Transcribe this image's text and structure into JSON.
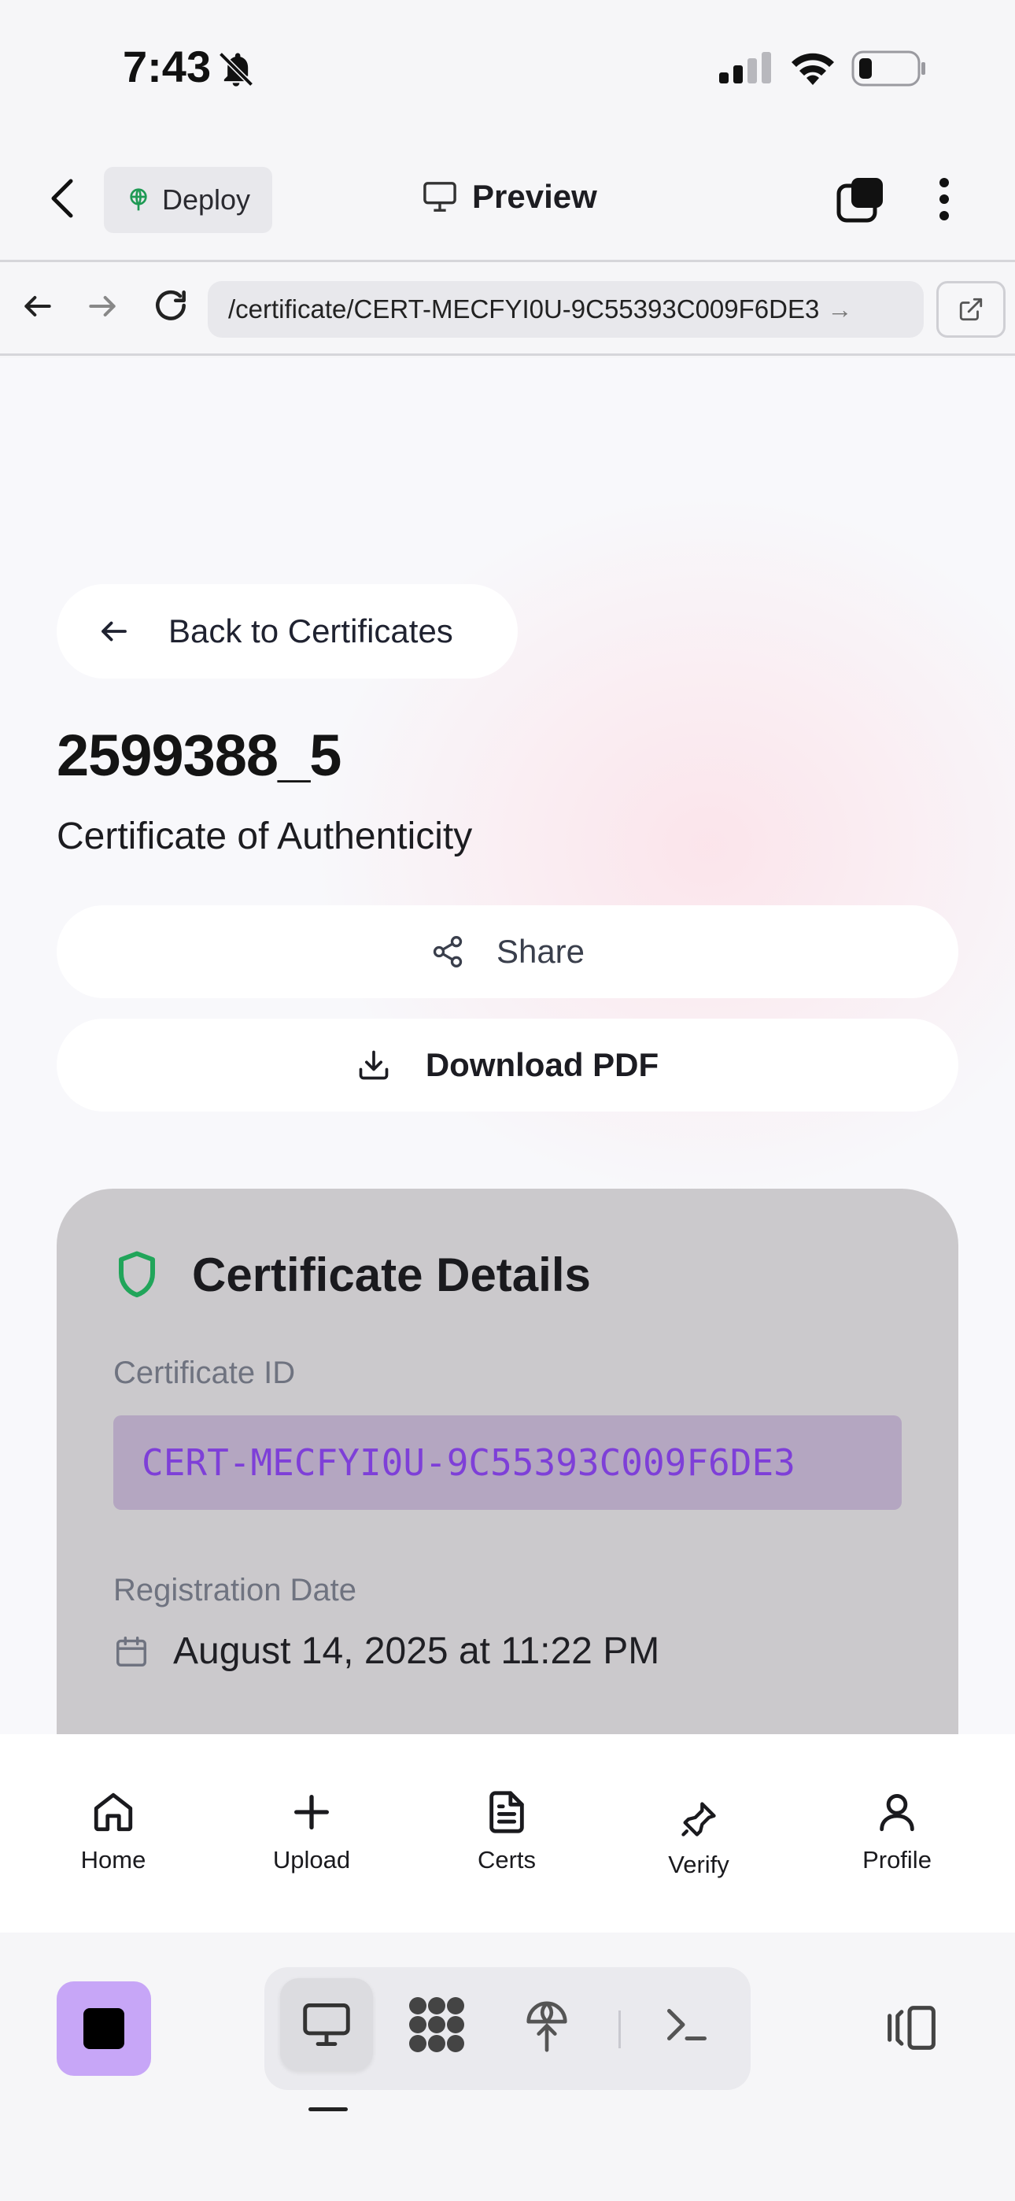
{
  "status_bar": {
    "time": "7:43",
    "icons": [
      "bell-slash-icon",
      "cellular-signal-icon",
      "wifi-icon",
      "battery-icon"
    ]
  },
  "app_bar": {
    "deploy_label": "Deploy",
    "preview_label": "Preview",
    "icons": [
      "back-chevron-icon",
      "deploy-globe-icon",
      "monitor-icon",
      "tabs-icon",
      "more-vertical-icon"
    ]
  },
  "browser": {
    "url": "/certificate/CERT-MECFYI0U-9C55393C009F6DE3",
    "url_suffix": "→",
    "icons": [
      "arrow-left-icon",
      "arrow-right-icon",
      "reload-icon",
      "external-link-icon"
    ]
  },
  "page": {
    "back_label": "Back to Certificates",
    "title": "2599388_5",
    "subtitle": "Certificate of Authenticity",
    "share_label": "Share",
    "download_label": "Download PDF",
    "details": {
      "heading": "Certificate Details",
      "id_label": "Certificate ID",
      "id_value": "CERT-MECFYI0U-9C55393C009F6DE3",
      "date_label": "Registration Date",
      "date_value": "August 14, 2025 at 11:22 PM"
    }
  },
  "bottom_nav": {
    "items": [
      {
        "label": "Home",
        "icon": "home-icon"
      },
      {
        "label": "Upload",
        "icon": "plus-icon"
      },
      {
        "label": "Certs",
        "icon": "file-text-icon"
      },
      {
        "label": "Verify",
        "icon": "stamp-icon"
      },
      {
        "label": "Profile",
        "icon": "user-icon"
      }
    ]
  },
  "dev_bar": {
    "icons": [
      "stop-icon",
      "desktop-preview-icon",
      "apps-grid-icon",
      "deploy-icon",
      "terminal-icon",
      "panel-toggle-icon"
    ],
    "active": "desktop-preview-icon"
  },
  "colors": {
    "accent_purple": "#7e3fd8",
    "shield_green": "#21a55a",
    "stop_button": "#c7a6f7",
    "card_grey": "#cbc9cc"
  }
}
